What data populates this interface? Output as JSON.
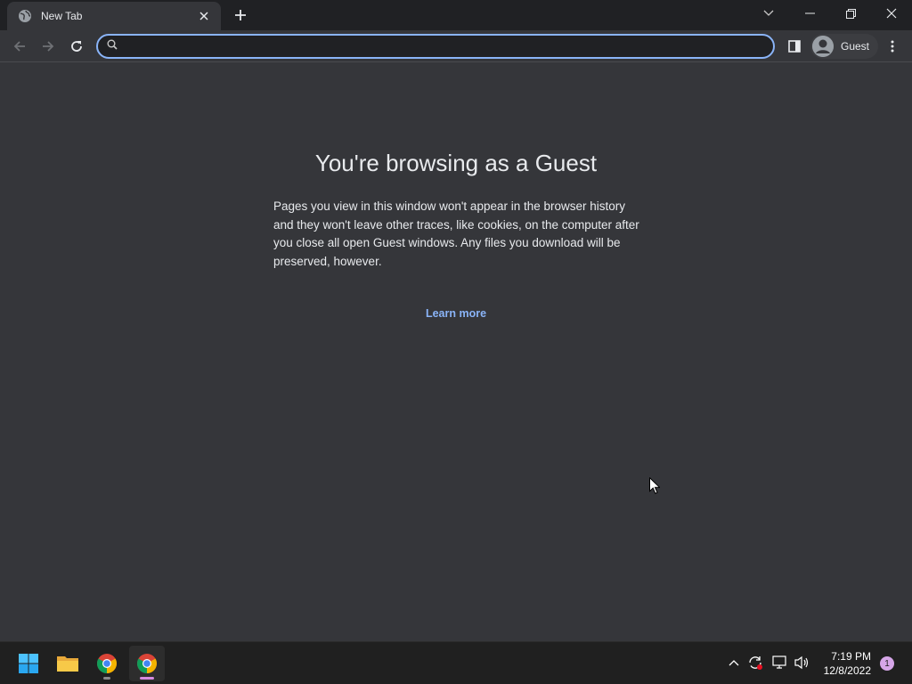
{
  "browser": {
    "tab": {
      "title": "New Tab",
      "favicon": "globe-icon"
    },
    "omnibox": {
      "value": "",
      "placeholder": ""
    },
    "profile": {
      "label": "Guest"
    }
  },
  "page": {
    "heading": "You're browsing as a Guest",
    "description": "Pages you view in this window won't appear in the browser history and they won't leave other traces, like cookies, on the computer after you close all open Guest windows. Any files you download will be preserved, however.",
    "learn_more": "Learn more"
  },
  "taskbar": {
    "apps": [
      "start-icon",
      "file-explorer-icon",
      "chrome-icon",
      "chrome-icon"
    ],
    "clock": {
      "time": "7:19 PM",
      "date": "12/8/2022"
    },
    "notifications": "1"
  },
  "colors": {
    "accent": "#8ab4f8",
    "background": "#35363a",
    "tabstrip": "#202124"
  }
}
